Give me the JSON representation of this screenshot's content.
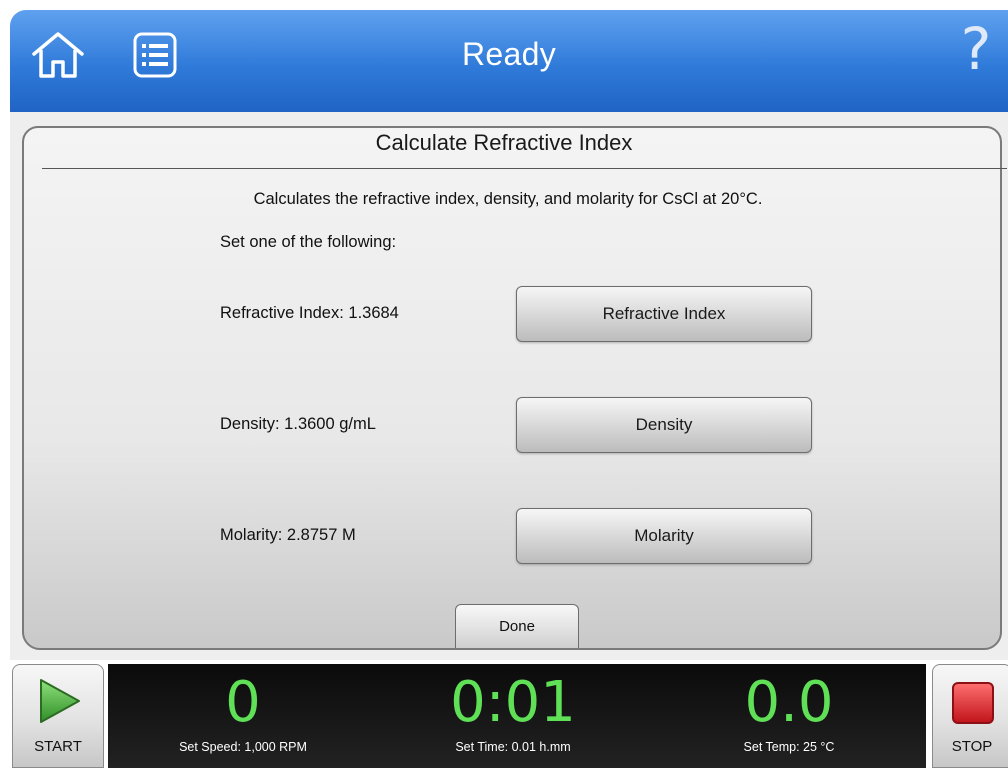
{
  "header": {
    "title": "Ready",
    "home_icon": "home-icon",
    "menu_icon": "list-menu-icon",
    "help_icon": "help-icon",
    "help_glyph": "?"
  },
  "panel": {
    "title": "Calculate Refractive Index",
    "description": "Calculates the refractive index, density, and molarity for CsCl at 20°C.",
    "instruction": "Set one of the following:",
    "rows": [
      {
        "label": "Refractive Index: 1.3684",
        "button": "Refractive Index"
      },
      {
        "label": "Density: 1.3600 g/mL",
        "button": "Density"
      },
      {
        "label": "Molarity: 2.8757 M",
        "button": "Molarity"
      }
    ],
    "done_label": "Done"
  },
  "status_bar": {
    "start_label": "START",
    "stop_label": "STOP",
    "speed": {
      "value": "0",
      "set": "Set Speed: 1,000 RPM"
    },
    "time": {
      "value": "0:01",
      "set": "Set Time: 0.01 h.mm"
    },
    "temp": {
      "value": "0.0",
      "set": "Set Temp: 25 °C"
    }
  },
  "colors": {
    "header_blue": "#2f7ad9",
    "readout_green": "#5fe056",
    "start_green": "#4caf3a",
    "stop_red": "#d9232a"
  }
}
